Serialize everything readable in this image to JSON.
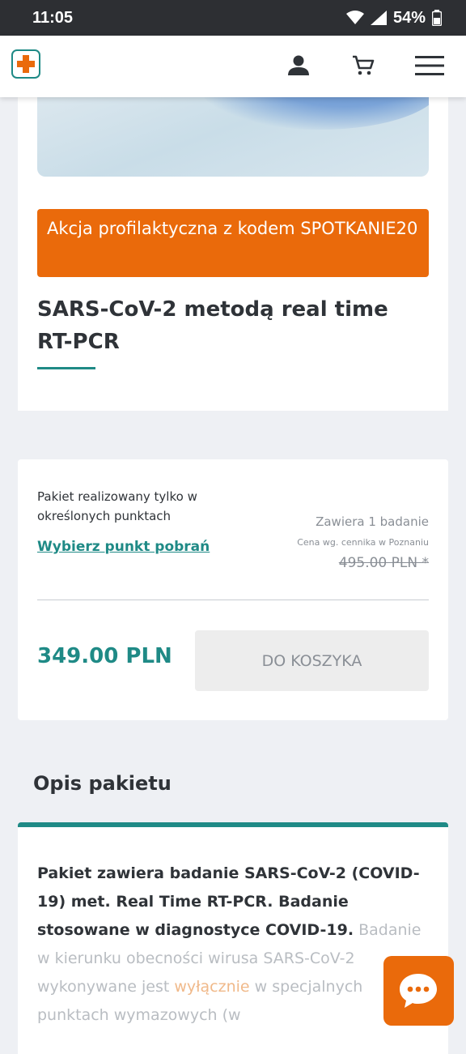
{
  "status_bar": {
    "time": "11:05",
    "battery": "54%"
  },
  "header": {
    "logo_icon": "medical-cross-logo",
    "icons": [
      "user-icon",
      "cart-icon",
      "menu-icon"
    ]
  },
  "product": {
    "promo_text": "Akcja profilaktyczna z kodem SPOTKANIE20",
    "title": "SARS-CoV-2 metodą real time RT-PCR"
  },
  "offer": {
    "availability_note": "Pakiet realizowany tylko w określonych punktach",
    "choose_point_link": "Wybierz punkt pobrań",
    "contains": "Zawiera 1 badanie",
    "price_note": "Cena wg. cennika w Poznaniu",
    "old_price": "495.00 PLN *",
    "price": "349.00 PLN",
    "add_to_cart_label": "DO KOSZYKA"
  },
  "description": {
    "section_title": "Opis pakietu",
    "text_bold": "Pakiet zawiera badanie SARS-CoV-2 (COVID-19) met. Real Time RT-PCR. Badanie stosowane w diagnostyce COVID-19.",
    "text_faded_1": "Badanie w kierunku obecności wirusa SARS-CoV-2 wykonywane jest",
    "text_accent": "wyłącznie",
    "text_faded_2": "w specjalnych punktach wymazowych (w"
  },
  "colors": {
    "accent": "#1f8a86",
    "promo": "#ea6a0b"
  }
}
